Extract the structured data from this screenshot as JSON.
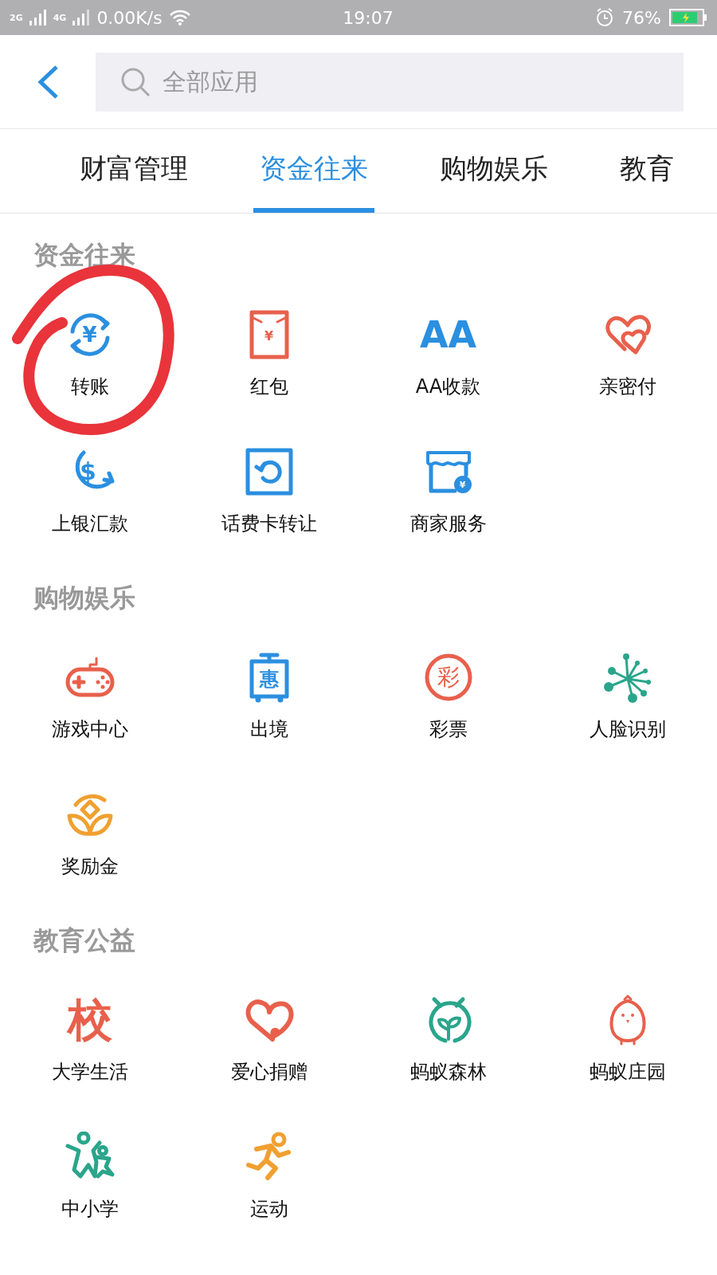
{
  "status_bar": {
    "network_1": "2G",
    "network_2": "4G",
    "speed": "0.00K/s",
    "time": "19:07",
    "battery": "76%"
  },
  "header": {
    "search": {
      "placeholder": "全部应用"
    }
  },
  "tabs": [
    {
      "label": "财富管理",
      "selected": false
    },
    {
      "label": "资金往来",
      "selected": true
    },
    {
      "label": "购物娱乐",
      "selected": false
    },
    {
      "label": "教育",
      "selected": false
    }
  ],
  "sections": [
    {
      "title": "资金往来",
      "apps": [
        {
          "label": "转账",
          "kind": "transfer",
          "glyph": "¥"
        },
        {
          "label": "红包",
          "kind": "envelope",
          "glyph": "¥"
        },
        {
          "label": "AA收款",
          "kind": "letters",
          "glyph": "AA"
        },
        {
          "label": "亲密付",
          "kind": "hearts"
        },
        {
          "label": "上银汇款",
          "kind": "dollar",
          "glyph": "$"
        },
        {
          "label": "话费卡转让",
          "kind": "card"
        },
        {
          "label": "商家服务",
          "kind": "shop",
          "glyph": "¥"
        }
      ]
    },
    {
      "title": "购物娱乐",
      "apps": [
        {
          "label": "游戏中心",
          "kind": "gamepad"
        },
        {
          "label": "出境",
          "kind": "luggage",
          "glyph": "惠"
        },
        {
          "label": "彩票",
          "kind": "lottery",
          "glyph": "彩"
        },
        {
          "label": "人脸识别",
          "kind": "dots"
        },
        {
          "label": "奖励金",
          "kind": "flower"
        }
      ]
    },
    {
      "title": "教育公益",
      "apps": [
        {
          "label": "大学生活",
          "kind": "school",
          "glyph": "校"
        },
        {
          "label": "爱心捐赠",
          "kind": "heart"
        },
        {
          "label": "蚂蚁森林",
          "kind": "sprout"
        },
        {
          "label": "蚂蚁庄园",
          "kind": "chick"
        },
        {
          "label": "中小学",
          "kind": "kids"
        },
        {
          "label": "运动",
          "kind": "runner"
        }
      ]
    }
  ]
}
